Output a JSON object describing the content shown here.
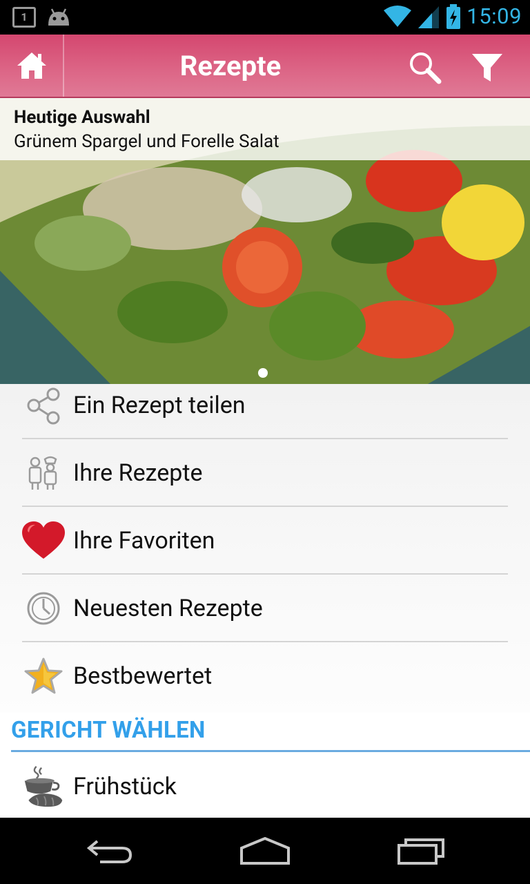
{
  "status_bar": {
    "notification_badge": "1",
    "time": "15:09",
    "icons": [
      "notification-box-icon",
      "android-icon",
      "wifi-icon",
      "signal-icon",
      "battery-charging-icon"
    ]
  },
  "action_bar": {
    "title": "Rezepte",
    "icons": [
      "home-icon",
      "search-icon",
      "filter-icon"
    ]
  },
  "featured": {
    "kicker": "Heutige Auswahl",
    "title": "Grünem Spargel und Forelle Salat"
  },
  "menu": {
    "items": [
      {
        "label": "Ein Rezept teilen",
        "icon": "share-icon"
      },
      {
        "label": "Ihre Rezepte",
        "icon": "chef-icon"
      },
      {
        "label": "Ihre Favoriten",
        "icon": "heart-icon"
      },
      {
        "label": "Neuesten Rezepte",
        "icon": "clock-icon"
      },
      {
        "label": "Bestbewertet",
        "icon": "star-icon"
      }
    ]
  },
  "section": {
    "header": "GERICHT WÄHLEN",
    "items": [
      {
        "label": "Frühstück",
        "icon": "breakfast-icon"
      }
    ]
  },
  "nav_bar": {
    "icons": [
      "back-icon",
      "home-nav-icon",
      "recent-apps-icon"
    ]
  },
  "colors": {
    "action_bar": "#d9557b",
    "accent_blue": "#33a0ea",
    "status_time": "#33b5e5"
  }
}
